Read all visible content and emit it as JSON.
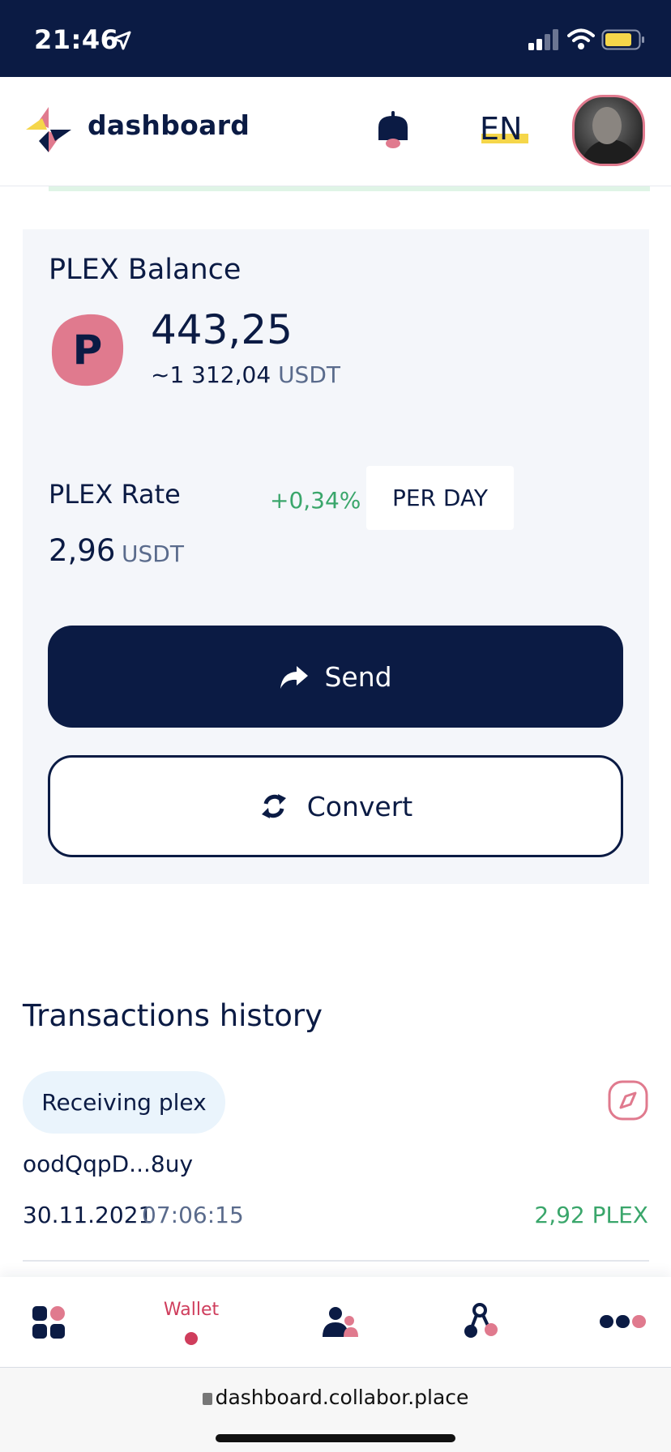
{
  "status_bar": {
    "time": "21:46"
  },
  "header": {
    "app_name": "dashboard",
    "language": "EN"
  },
  "balance_card": {
    "title": "PLEX Balance",
    "coin_letter": "P",
    "amount": "443,25",
    "usdt_prefix": "~1 312,04",
    "usdt_unit": "USDT",
    "rate_label": "PLEX Rate",
    "rate_change": "+0,34%",
    "period": "PER DAY",
    "rate_value": "2,96",
    "rate_unit": "USDT",
    "send_label": "Send",
    "convert_label": "Convert"
  },
  "transactions": {
    "title": "Transactions history",
    "items": [
      {
        "type": "Receiving plex",
        "hash": "oodQqpD...8uy",
        "date": "30.11.2021",
        "time": "07:06:15",
        "amount": "2,92 PLEX"
      }
    ]
  },
  "bottom_nav": {
    "wallet_label": "Wallet"
  },
  "browser": {
    "url": "dashboard.collabor.place"
  },
  "colors": {
    "navy": "#0b1b44",
    "pink": "#e07a8e",
    "accent_red": "#cf3d5c",
    "green": "#3aa66b",
    "yellow": "#f5d64a",
    "card_bg": "#f4f6fa"
  }
}
